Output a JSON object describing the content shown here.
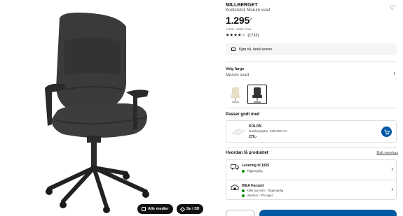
{
  "gallery": {
    "all_media_label": "Alle medier",
    "view_3d_label": "Se i 3D"
  },
  "product": {
    "name": "MILLBERGET",
    "description": "Kontorstol, Murum svart",
    "price_main": "1.295",
    "price_suffix": ",-",
    "vat_note": "1.036,- ekskl. mva",
    "stars": "★★★★☆",
    "review_count": "(1733)",
    "klarna_text": "Kjøp nå, betal senere"
  },
  "color": {
    "title": "Velg farge",
    "value": "Murum svart",
    "swatches": [
      "beige",
      "svart"
    ]
  },
  "pairs_with": {
    "title": "Passer godt med",
    "item_name": "KOLON",
    "item_desc": "Gulvbeskytter, 120x100 cm",
    "item_price": "279,-"
  },
  "get_product": {
    "title": "Hvordan få produktet",
    "change_store": "Bytt varehus",
    "delivery_title": "Levering til 1825",
    "delivery_status": "Tilgjengelig",
    "store_title": "IKEA Furuset",
    "store_status_1": "Klikk og hent - Tilgjengelig",
    "store_status_2": "Varehus - På lager"
  },
  "colors": {
    "ikea_blue": "#0058a3",
    "in_stock_green": "#0a8a00"
  }
}
